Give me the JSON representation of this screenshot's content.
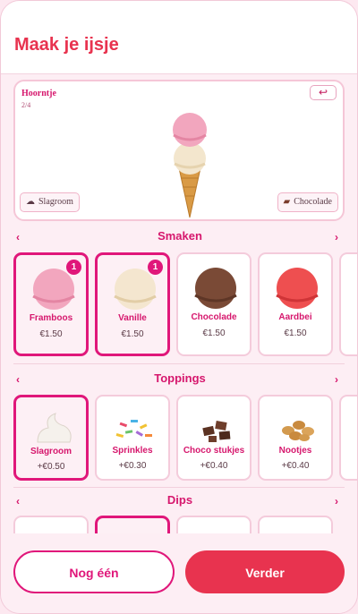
{
  "header": {
    "title": "Maak je ijsje"
  },
  "preview": {
    "cone": "Hoorntje",
    "counter": "2/4",
    "undo_icon": "undo-icon",
    "chip_left": {
      "label": "Slagroom",
      "icon": "cream-icon"
    },
    "chip_right": {
      "label": "Chocolade",
      "icon": "chocolate-icon"
    }
  },
  "sections": {
    "flavors": {
      "title": "Smaken",
      "items": [
        {
          "name": "Framboos",
          "price": "€1.50",
          "badge": "1",
          "selected": true,
          "color": "#f2a6be"
        },
        {
          "name": "Vanille",
          "price": "€1.50",
          "badge": "1",
          "selected": true,
          "color": "#f4e6cf"
        },
        {
          "name": "Chocolade",
          "price": "€1.50",
          "selected": false,
          "color": "#7a4a36"
        },
        {
          "name": "Aardbei",
          "price": "€1.50",
          "selected": false,
          "color": "#ee4f50"
        }
      ]
    },
    "toppings": {
      "title": "Toppings",
      "items": [
        {
          "name": "Slagroom",
          "price": "+€0.50",
          "selected": true
        },
        {
          "name": "Sprinkles",
          "price": "+€0.30",
          "selected": false
        },
        {
          "name": "Choco stukjes",
          "price": "+€0.40",
          "selected": false
        },
        {
          "name": "Nootjes",
          "price": "+€0.40",
          "selected": false
        }
      ]
    },
    "dips": {
      "title": "Dips"
    }
  },
  "footer": {
    "secondary": "Nog één",
    "primary": "Verder"
  },
  "colors": {
    "accent": "#e0177a",
    "primary_button": "#e8334f",
    "background": "#fdeef4"
  }
}
